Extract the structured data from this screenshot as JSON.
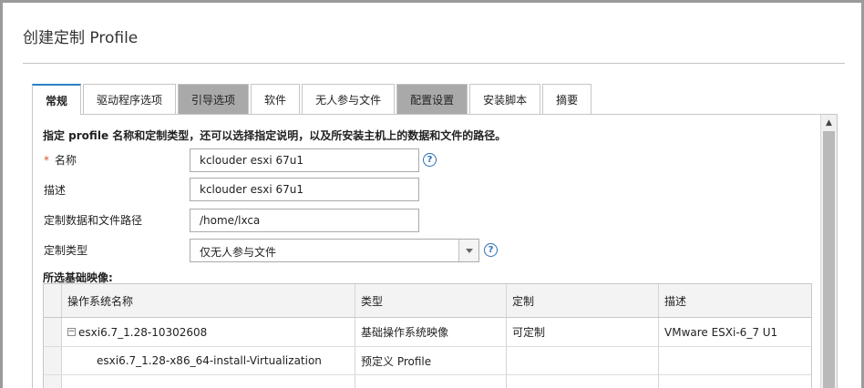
{
  "dialog": {
    "title": "创建定制 Profile"
  },
  "tabs": [
    {
      "label": "常规",
      "state": "active"
    },
    {
      "label": "驱动程序选项",
      "state": "normal"
    },
    {
      "label": "引导选项",
      "state": "disabled"
    },
    {
      "label": "软件",
      "state": "normal"
    },
    {
      "label": "无人参与文件",
      "state": "normal"
    },
    {
      "label": "配置设置",
      "state": "disabled"
    },
    {
      "label": "安装脚本",
      "state": "normal"
    },
    {
      "label": "摘要",
      "state": "normal"
    }
  ],
  "form": {
    "intro": "指定 profile 名称和定制类型，还可以选择指定说明，以及所安装主机上的数据和文件的路径。",
    "required_mark": "*",
    "name_label": "名称",
    "name_value": "kclouder esxi 67u1",
    "description_label": "描述",
    "description_value": "kclouder esxi 67u1",
    "path_label": "定制数据和文件路径",
    "path_value": "/home/lxca",
    "type_label": "定制类型",
    "type_value": "仅无人参与文件",
    "help_glyph": "?"
  },
  "images": {
    "section_label": "所选基础映像:",
    "columns": [
      "操作系统名称",
      "类型",
      "定制",
      "描述"
    ],
    "rows": [
      {
        "expander": "−",
        "name": "esxi6.7_1.28-10302608",
        "type": "基础操作系统映像",
        "custom": "可定制",
        "desc": "VMware ESXi-6_7 U1"
      },
      {
        "name": "esxi6.7_1.28-x86_64-install-Virtualization",
        "type": "预定义 Profile",
        "custom": "",
        "desc": ""
      }
    ]
  },
  "colors": {
    "active_tab_accent": "#2d7fc4",
    "disabled_tab_bg": "#a9a9a9",
    "required_mark": "#d9552b",
    "help_icon": "#2d6fb5"
  },
  "icons": {
    "help": "help-circle-icon",
    "dropdown": "chevron-down-icon",
    "collapse": "minus-square-icon",
    "scroll_up": "arrow-up-icon"
  }
}
